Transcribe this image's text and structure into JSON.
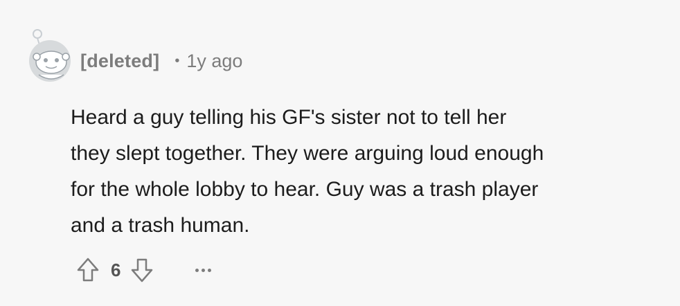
{
  "comment": {
    "author": "[deleted]",
    "separator": "•",
    "time": "1y ago",
    "body_lines": [
      "Heard a guy telling his GF's sister not to tell her",
      "they slept together. They were arguing loud enough",
      "for the whole lobby to hear. Guy was a trash player",
      "and a trash human."
    ],
    "score": "6"
  },
  "icons": {
    "avatar": "snoo-avatar-icon",
    "upvote": "upvote-arrow-icon",
    "downvote": "downvote-arrow-icon",
    "more": "more-options-icon"
  },
  "colors": {
    "background": "#f7f7f7",
    "meta_text": "#7c7c7c",
    "body_text": "#1c1c1c"
  }
}
